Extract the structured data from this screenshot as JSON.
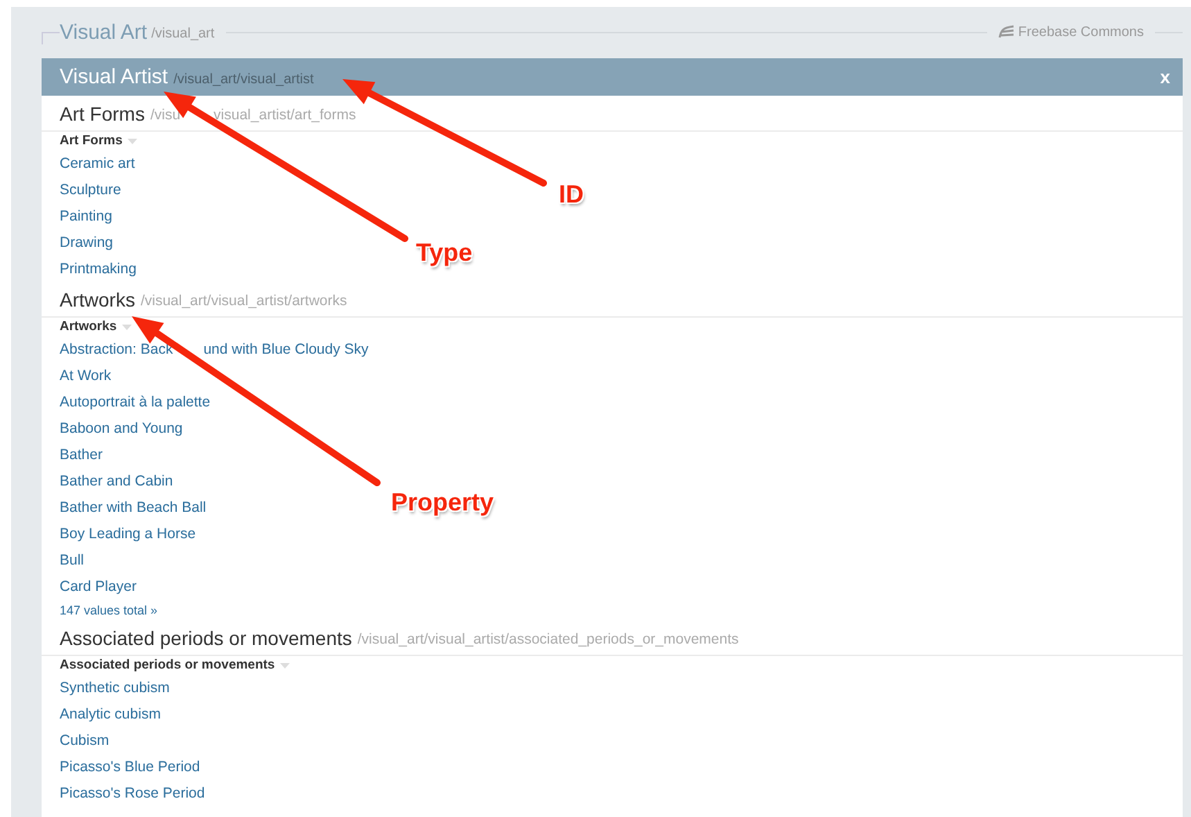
{
  "section": {
    "title": "Visual Art",
    "path": "/visual_art",
    "source": "Freebase Commons"
  },
  "type": {
    "title": "Visual Artist",
    "path": "/visual_art/visual_artist",
    "close": "x"
  },
  "properties": [
    {
      "title": "Art Forms",
      "path": [
        "/visu",
        "visual_artist/art_forms"
      ],
      "label": "Art Forms",
      "values": [
        "Ceramic art",
        "Sculpture",
        "Painting",
        "Drawing",
        "Printmaking"
      ]
    },
    {
      "title": "Artworks",
      "path": "/visual_art/visual_artist/artworks",
      "label": "Artworks",
      "values": [
        [
          "Abstraction: Back",
          "und with Blue Cloudy Sky"
        ],
        "At Work",
        "Autoportrait à la palette",
        "Baboon and Young",
        "Bather",
        "Bather and Cabin",
        "Bather with Beach Ball",
        "Boy Leading a Horse",
        "Bull",
        "Card Player"
      ],
      "more": "147 values total »"
    },
    {
      "title": "Associated periods or movements",
      "path": "/visual_art/visual_artist/associated_periods_or_movements",
      "label": "Associated periods or movements",
      "values": [
        "Synthetic cubism",
        "Analytic cubism",
        "Cubism",
        "Picasso's Blue Period",
        "Picasso's Rose Period"
      ]
    }
  ],
  "annotations": [
    {
      "label": "ID"
    },
    {
      "label": "Type"
    },
    {
      "label": "Property"
    }
  ]
}
